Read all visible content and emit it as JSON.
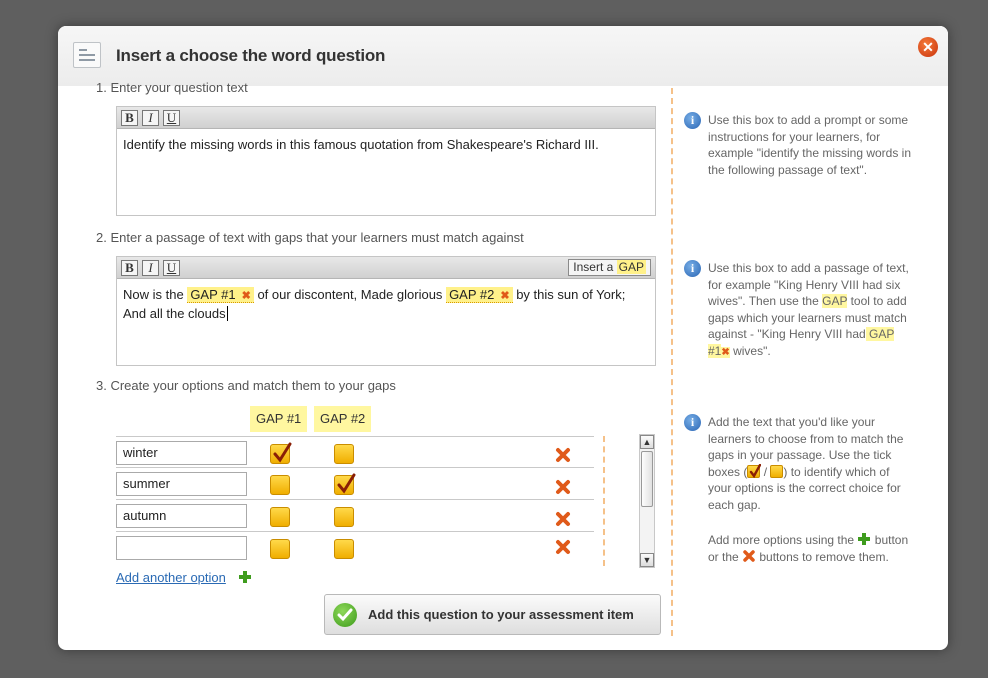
{
  "dialog": {
    "title": "Insert a choose the word question"
  },
  "steps": {
    "step1": "1.  Enter your question text",
    "step2": "2.  Enter a passage of text with gaps that your learners must match against",
    "step3": "3.  Create your options and match them to your gaps"
  },
  "toolbar": {
    "bold": "B",
    "italic": "I",
    "underline": "U"
  },
  "question_text": "Identify the missing words in this famous quotation from Shakespeare's Richard III.",
  "insert_gap": {
    "prefix": "Insert a",
    "gap": "GAP"
  },
  "passage": {
    "part1": "Now is the ",
    "gap1": "GAP #1",
    "part2": " of our discontent, Made glorious ",
    "gap2": "GAP #2",
    "part3": " by this sun of York; And all the clouds"
  },
  "gap_headers": [
    "GAP #1",
    "GAP #2"
  ],
  "options": [
    {
      "text": "winter",
      "gap1": true,
      "gap2": false
    },
    {
      "text": "summer",
      "gap1": false,
      "gap2": true
    },
    {
      "text": "autumn",
      "gap1": false,
      "gap2": false
    },
    {
      "text": "",
      "gap1": false,
      "gap2": false
    }
  ],
  "add_option_label": "Add another option",
  "submit_label": "Add this question to your assessment item",
  "help": {
    "h1": "Use this box to add a prompt or some instructions for your learners, for example \"identify the missing words in the following passage of text\".",
    "h2a": "Use this box to add a passage of text, for example \"King Henry VIII had six wives\". Then use the ",
    "h2_gap": "GAP",
    "h2b": " tool to add gaps which your learners must match against - \"King Henry VIII had",
    "h2_gap1": " GAP #1",
    "h2c": " wives\".",
    "h3a": "Add the text that you'd like your learners to choose from to match the gaps in your passage. Use the tick boxes (",
    "h3_sep": " / ",
    "h3b": ") to identify which of your options is the correct choice for each gap.",
    "h4a": "Add more options using the",
    "h4b": "button or the",
    "h4c": "buttons to remove them."
  },
  "colors": {
    "accent_orange": "#e05a1a",
    "gap_yellow": "#fff18a",
    "link_blue": "#2a6ab4",
    "info_blue": "#2a65b4"
  }
}
